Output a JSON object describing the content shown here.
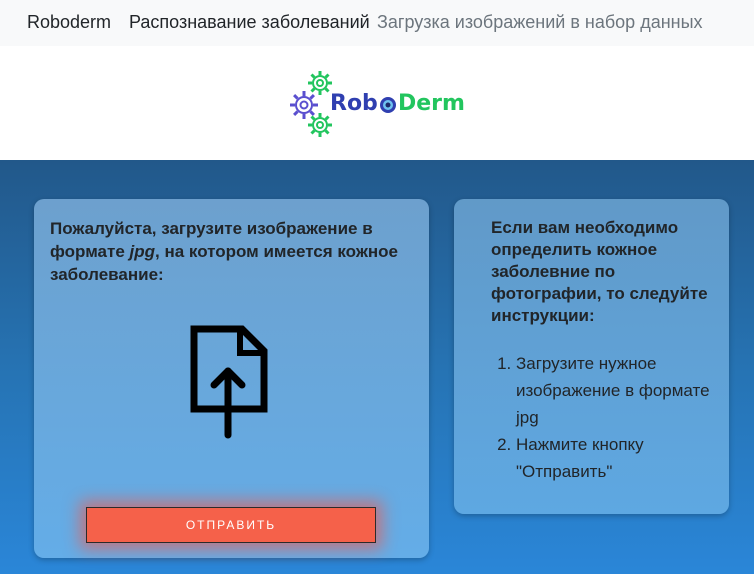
{
  "navbar": {
    "brand": "Roboderm",
    "links": [
      {
        "label": "Распознавание заболеваний"
      },
      {
        "label": "Загрузка изображений в набор данных"
      }
    ]
  },
  "logo": {
    "text_left": "Rob",
    "text_right": "Derm",
    "colors": {
      "gear": "#5a4fcf",
      "gear_green": "#22c55e",
      "rob": "#2f3fb0",
      "derm": "#22c55e"
    }
  },
  "upload_card": {
    "text_part1": "Пожалуйста, загрузите изображение в формате ",
    "text_format": "jpg",
    "text_part2": ", на котором имеется кожное заболевание:",
    "upload_icon": "file-upload-icon",
    "submit_label": "ОТПРАВИТЬ"
  },
  "instructions": {
    "title": "Если вам необходимо определить кожное заболевние по фотографии, то следуйте инструкции:",
    "steps": [
      "Загрузите нужное изображение в формате jpg",
      "Нажмите кнопку \"Отправить\""
    ]
  },
  "colors": {
    "accent_button": "#f5614a",
    "background_top": "#22588a",
    "background_bottom": "#2a86d8"
  }
}
